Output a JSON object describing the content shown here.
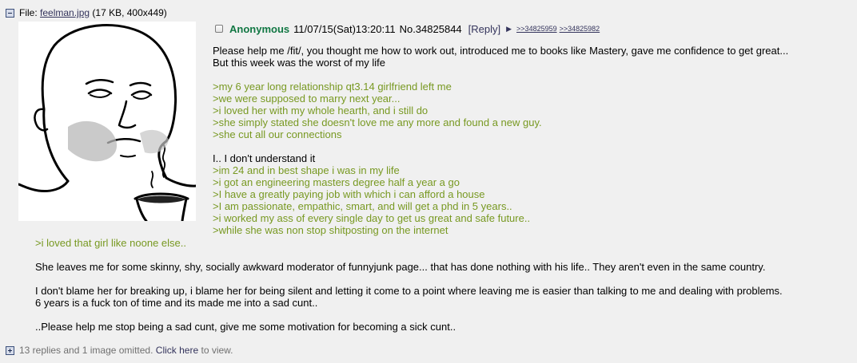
{
  "file": {
    "label": "File:",
    "name": "feelman.jpg",
    "info": "(17 KB, 400x449)"
  },
  "thumbnail": {
    "alt": "feelman.jpg"
  },
  "post": {
    "name": "Anonymous",
    "datetime": "11/07/15(Sat)13:20:11",
    "number": "No.34825844",
    "reply_label": "[Reply]",
    "arrow_icon": "▶",
    "backlinks": [
      ">>34825959",
      ">>34825982"
    ]
  },
  "body": {
    "top_lines": [
      {
        "text": "Please help me /fit/, you thought me how to work out, introduced me to books like Mastery, gave me confidence to get great...",
        "type": "text"
      },
      {
        "text": "But this week was the worst of my life",
        "type": "text"
      },
      {
        "text": "",
        "type": "gap"
      },
      {
        "text": ">my 6 year long relationship qt3.14 girlfriend left me",
        "type": "quote"
      },
      {
        "text": ">we were supposed to marry next year...",
        "type": "quote"
      },
      {
        "text": ">i loved her with my whole hearth, and i still do",
        "type": "quote"
      },
      {
        "text": ">she simply stated she doesn't love me any more and found a new guy.",
        "type": "quote"
      },
      {
        "text": ">she cut all our connections",
        "type": "quote"
      },
      {
        "text": "",
        "type": "gap"
      },
      {
        "text": "I.. I don't understand it",
        "type": "text"
      },
      {
        "text": ">im 24 and in best shape i was in my life",
        "type": "quote"
      },
      {
        "text": ">i got an engineering masters degree half a year a go",
        "type": "quote"
      },
      {
        "text": ">I have a greatly paying job with which i can afford a house",
        "type": "quote"
      },
      {
        "text": ">I am passionate, empathic, smart, and will get a phd in 5 years..",
        "type": "quote"
      },
      {
        "text": ">i worked my ass of every single day to get us great and safe future..",
        "type": "quote"
      },
      {
        "text": ">while she was non stop shitposting on the internet",
        "type": "quote"
      }
    ],
    "bottom_lines": [
      {
        "text": ">i loved that girl like noone else..",
        "type": "quote"
      },
      {
        "text": "",
        "type": "gap"
      },
      {
        "text": "She leaves me for some skinny, shy, socially awkward moderator of funnyjunk page... that has done nothing with his life.. They aren't even in the same country.",
        "type": "text"
      },
      {
        "text": "",
        "type": "gap"
      },
      {
        "text": "I don't blame her for breaking up, i blame her for being silent and letting it come to a point where leaving me is easier than talking to me and dealing with problems.",
        "type": "text"
      },
      {
        "text": "6 years is a fuck ton of time and its made me into a sad cunt..",
        "type": "text"
      },
      {
        "text": "",
        "type": "gap"
      },
      {
        "text": "..Please help me stop being a sad cunt, give me some motivation for becoming a sick cunt..",
        "type": "text"
      }
    ]
  },
  "omitted": {
    "prefix": "13 replies and 1 image omitted.",
    "link": "Click here",
    "suffix": "to view."
  },
  "colors": {
    "background": "#f0f0f0",
    "name": "#117743",
    "quote": "#789922",
    "link": "#34345c"
  }
}
